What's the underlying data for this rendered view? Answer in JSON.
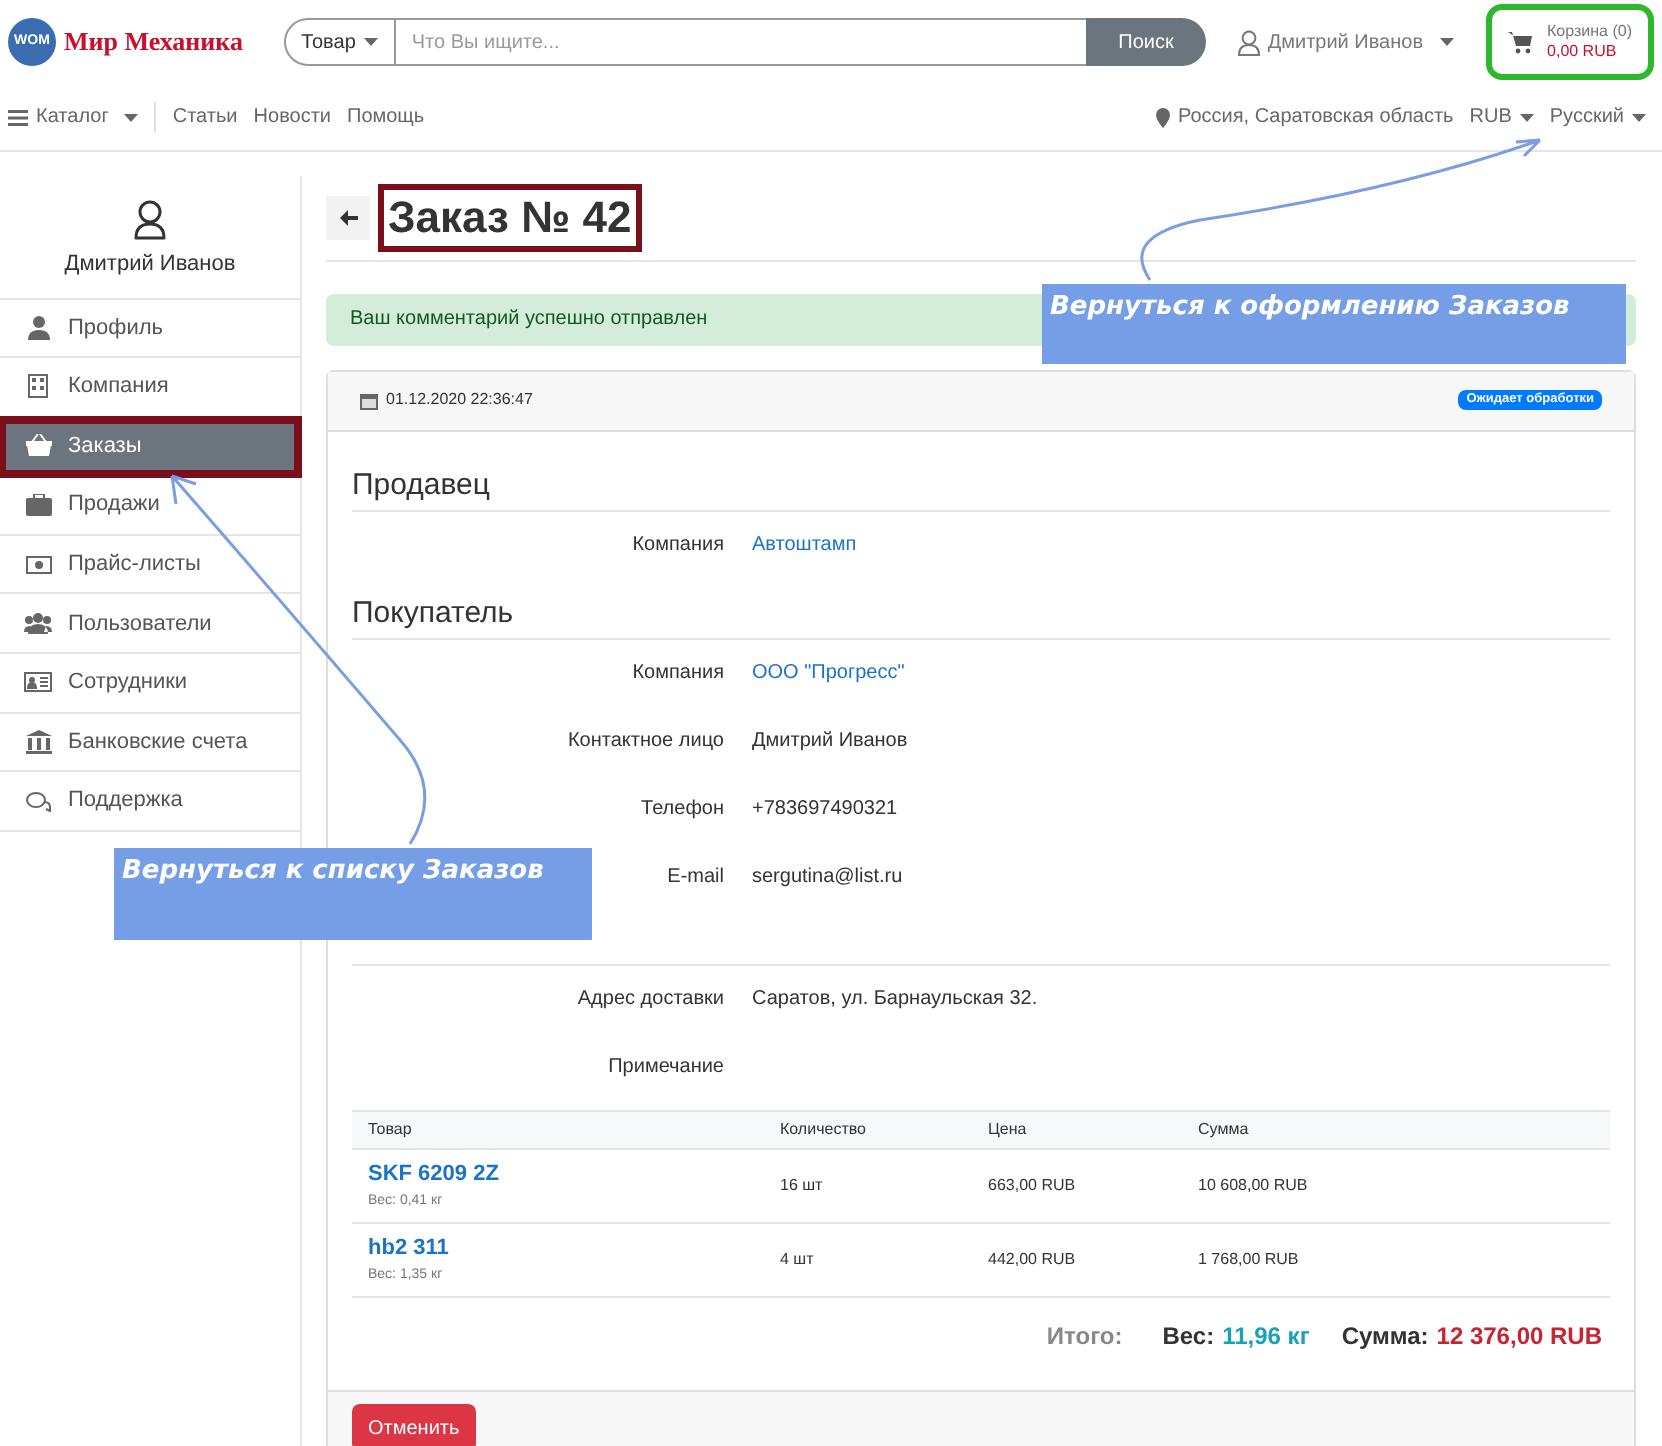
{
  "header": {
    "logo_mark": "WOM",
    "logo_text": "Мир Механика",
    "search": {
      "category": "Товар",
      "placeholder": "Что Вы ищите...",
      "button": "Поиск"
    },
    "user": "Дмитрий Иванов",
    "cart": {
      "label": "Корзина (0)",
      "total": "0,00 RUB"
    }
  },
  "nav": {
    "items": [
      {
        "label": "Каталог",
        "kind": "dropdown"
      },
      {
        "label": "Статьи",
        "kind": "link"
      },
      {
        "label": "Новости",
        "kind": "link"
      },
      {
        "label": "Помощь",
        "kind": "link"
      }
    ],
    "location": "Россия, Саратовская область",
    "currency": "RUB",
    "language": "Русский"
  },
  "sidebar": {
    "user": "Дмитрий Иванов",
    "items": [
      {
        "label": "Профиль",
        "selected": false
      },
      {
        "label": "Компания",
        "selected": false
      },
      {
        "label": "Заказы",
        "selected": true
      },
      {
        "label": "Продажи",
        "selected": false
      },
      {
        "label": "Прайс-листы",
        "selected": false
      },
      {
        "label": "Пользователи",
        "selected": false
      },
      {
        "label": "Сотрудники",
        "selected": false
      },
      {
        "label": "Банковские счета",
        "selected": false
      },
      {
        "label": "Поддержка",
        "selected": false
      }
    ]
  },
  "page": {
    "title": "Заказ № 42",
    "alert": "Ваш комментарий успешно отправлен",
    "date": "01.12.2020 22:36:47",
    "status": "Ожидает обработки",
    "sections": [
      {
        "title": "Продавец",
        "fields": [
          {
            "label": "Компания",
            "value": "Автоштамп",
            "kind": "link"
          }
        ]
      },
      {
        "title": "Покупатель",
        "fields": [
          {
            "label": "Компания",
            "value": "ООО \"Прогресс\"",
            "kind": "link"
          },
          {
            "label": "Контактное лицо",
            "value": "Дмитрий Иванов",
            "kind": "text"
          },
          {
            "label": "Телефон",
            "value": "+783697490321",
            "kind": "text"
          },
          {
            "label": "E-mail",
            "value": "sergutina@list.ru",
            "kind": "text"
          }
        ]
      },
      {
        "fields": [
          {
            "label": "Адрес доставки",
            "value": "Саратов, ул. Барнаульская 32.",
            "kind": "text"
          },
          {
            "label": "Примечание"
          }
        ]
      }
    ],
    "table": {
      "columns": [
        "Товар",
        "Количество",
        "Цена",
        "Сумма"
      ],
      "rows": [
        {
          "name": "SKF 6209 2Z",
          "weight": "Вес: 0,41 кг",
          "qty": "16 шт",
          "price": "663,00 RUB",
          "sum": "10 608,00 RUB"
        },
        {
          "name": "hb2 311",
          "weight": "Вес: 1,35 кг",
          "qty": "4 шт",
          "price": "442,00 RUB",
          "sum": "1 768,00 RUB"
        }
      ]
    },
    "totals": {
      "label": "Итого:",
      "weight_label": "Вес:",
      "weight": "11,96 кг",
      "sum_label": "Сумма:",
      "sum": "12 376,00 RUB"
    },
    "cancel": "Отменить"
  },
  "annotations": [
    "Вернуться к оформлению Заказов",
    "Вернуться к списку Заказов"
  ]
}
